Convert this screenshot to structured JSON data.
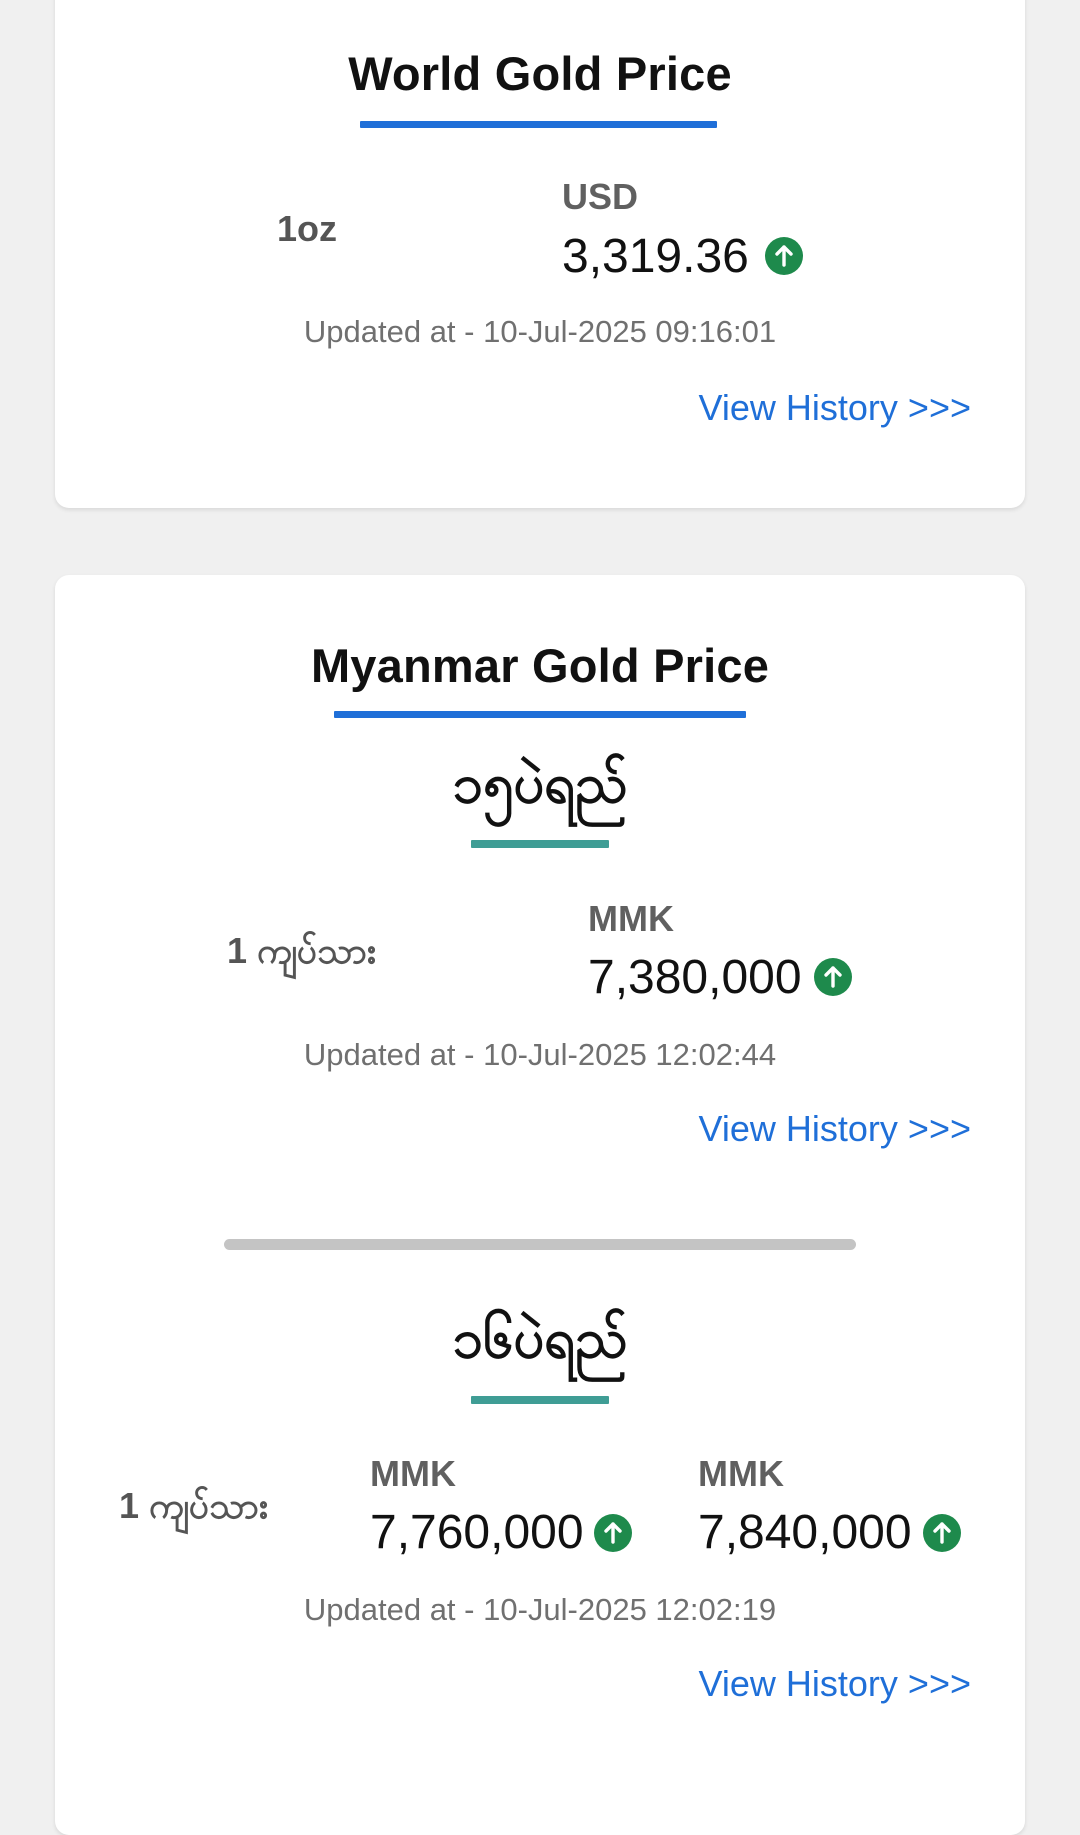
{
  "world": {
    "title": "World Gold Price",
    "unit": "1oz",
    "currency": "USD",
    "price": "3,319.36",
    "trend": "up",
    "updated": "Updated at - 10-Jul-2025 09:16:01",
    "history_link": "View History >>>"
  },
  "myanmar": {
    "title": "Myanmar Gold Price",
    "sections": [
      {
        "title": "၁၅ပဲရည်",
        "unit": "1 ကျပ်သား",
        "currency": "MMK",
        "price": "7,380,000",
        "trend": "up",
        "updated": "Updated at - 10-Jul-2025 12:02:44",
        "history_link": "View History >>>"
      },
      {
        "title": "၁၆ပဲရည်",
        "unit": "1 ကျပ်သား",
        "prices": [
          {
            "currency": "MMK",
            "price": "7,760,000",
            "trend": "up"
          },
          {
            "currency": "MMK",
            "price": "7,840,000",
            "trend": "up"
          }
        ],
        "updated": "Updated at - 10-Jul-2025 12:02:19",
        "history_link": "View History >>>"
      }
    ]
  },
  "colors": {
    "accent_blue": "#1f6fd8",
    "section_teal": "#3f9d95",
    "trend_up_green": "#1e8a4c",
    "background": "#f0f0f0"
  },
  "icons": {
    "trend_up": "arrow-up-circle-icon"
  }
}
